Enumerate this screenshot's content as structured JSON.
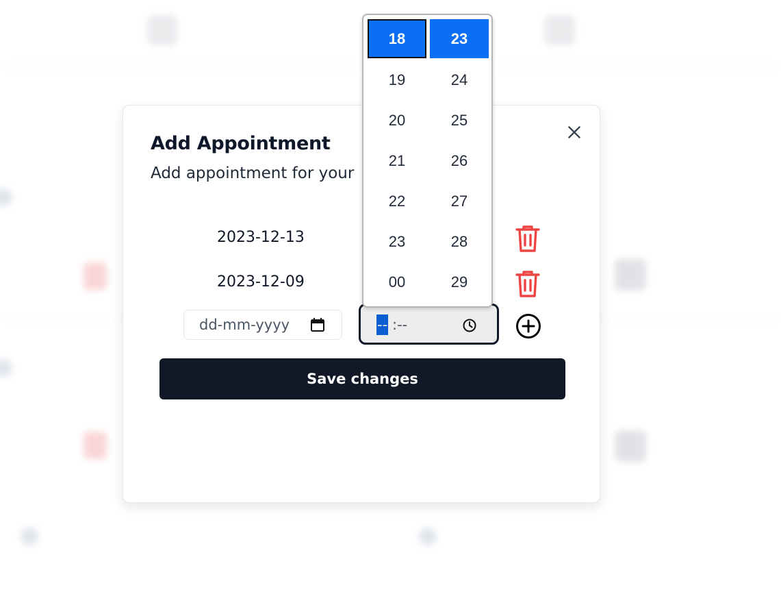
{
  "modal": {
    "title": "Add Appointment",
    "subtitle": "Add appointment for your",
    "close_icon": "close-icon",
    "appointments": [
      {
        "date": "2023-12-13"
      },
      {
        "date": "2023-12-09"
      }
    ],
    "new_date_placeholder": "dd-mm-yyyy",
    "new_time_hour": "--",
    "new_time_rest": ":--",
    "save_label": "Save changes"
  },
  "time_picker": {
    "hours": [
      "18",
      "19",
      "20",
      "21",
      "22",
      "23",
      "00"
    ],
    "minutes": [
      "23",
      "24",
      "25",
      "26",
      "27",
      "28",
      "29"
    ],
    "selected_hour": "18",
    "selected_minute": "23"
  },
  "colors": {
    "accent": "#0a6ff5",
    "danger": "#ef4444",
    "primary_button": "#111827"
  }
}
